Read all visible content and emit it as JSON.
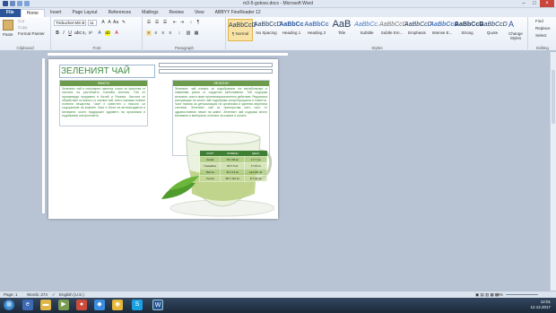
{
  "window": {
    "title": "m3-5-gotovo.docx - Microsoft Word",
    "min": "–",
    "max": "□",
    "close": "×"
  },
  "tabs": [
    "File",
    "Home",
    "Insert",
    "Page Layout",
    "References",
    "Mailings",
    "Review",
    "View",
    "ABBYY FineReader 12"
  ],
  "ribbon": {
    "clipboard": {
      "paste": "Paste",
      "cut": "Cut",
      "copy": "Copy",
      "painter": "Format Painter",
      "label": "Clipboard"
    },
    "font": {
      "name": "Trebuchet MS B",
      "size": "11",
      "bold": "B",
      "italic": "I",
      "underline": "U",
      "label": "Font"
    },
    "paragraph": {
      "label": "Paragraph"
    },
    "styles": {
      "items": [
        {
          "preview": "AaBbCcD",
          "name": "¶ Normal"
        },
        {
          "preview": "AaBbCcD",
          "name": "No Spacing"
        },
        {
          "preview": "AaBbCc",
          "name": "Heading 1"
        },
        {
          "preview": "AaBbCc",
          "name": "Heading 2"
        },
        {
          "preview": "AaB",
          "name": "Title"
        },
        {
          "preview": "AaBbCc.",
          "name": "Subtitle"
        },
        {
          "preview": "AaBbCcD",
          "name": "Subtle Em..."
        },
        {
          "preview": "AaBbCcD",
          "name": "Emphasis"
        },
        {
          "preview": "AaBbCcD",
          "name": "Intense E..."
        },
        {
          "preview": "AaBbCcD",
          "name": "Strong"
        },
        {
          "preview": "AaBbCcD",
          "name": "Quote"
        }
      ],
      "change": "Change Styles",
      "label": "Styles"
    },
    "editing": {
      "find": "Find",
      "replace": "Replace",
      "select": "Select",
      "label": "Editing"
    }
  },
  "document": {
    "heading": "ЗЕЛЕНИЯТ ЧАЙ",
    "col1_header": "ФАКТИ",
    "col2_header": "ЛЕЧЕНИ",
    "col1_text": "Зеленият чай е популярна напитка, която се приготвя от листата на растението Camellia sinensis. Той се произвежда предимно в Китай и Япония. Листата се обработват по-малко от черния чай, което запазва повече полезни вещества. Чаят е известен с ниското си съдържание на кофеин. Чаят е богат на антиоксиданти и витамини, които поддържат здравето на организма и подобряват настроението.",
    "col2_text": "Зеленият чай помага за подобряване на метаболизма и намалява риска от сърдечни заболявания. Той съдържа катехини, които имат противовъзпалително действие. Редовната консумация на зелен чай подобрява концентрацията и паметта. Чаят помага за детоксикация на организма и укрепва имунната система. Зеленият чай се препоръчва като част от здравословния начин на живот. Зеленият чай съдържа много витамини и минерали, полезни за кожата и косата.",
    "table": {
      "headers": [
        "СОРТ",
        "КОФЕИН",
        "ЦЕНА"
      ],
      "rows": [
        [
          "Китай",
          "75 ± 84 мг",
          "2 ± 7 лв"
        ],
        [
          "Генмайча",
          "80 ± 6 мг",
          "3 ± 8 лв"
        ],
        [
          "Матча",
          "33 ± 12 мг",
          "12 ± 40 лв"
        ],
        [
          "Сенча",
          "98 ± 110 мг",
          "8 ± 24 лв"
        ]
      ]
    }
  },
  "status": {
    "page": "Page: 1",
    "words": "Words: 274",
    "lang": "English (U.S.)",
    "zoom": "66%"
  },
  "taskbar": {
    "time": "12:01",
    "date": "12.12.2017"
  }
}
